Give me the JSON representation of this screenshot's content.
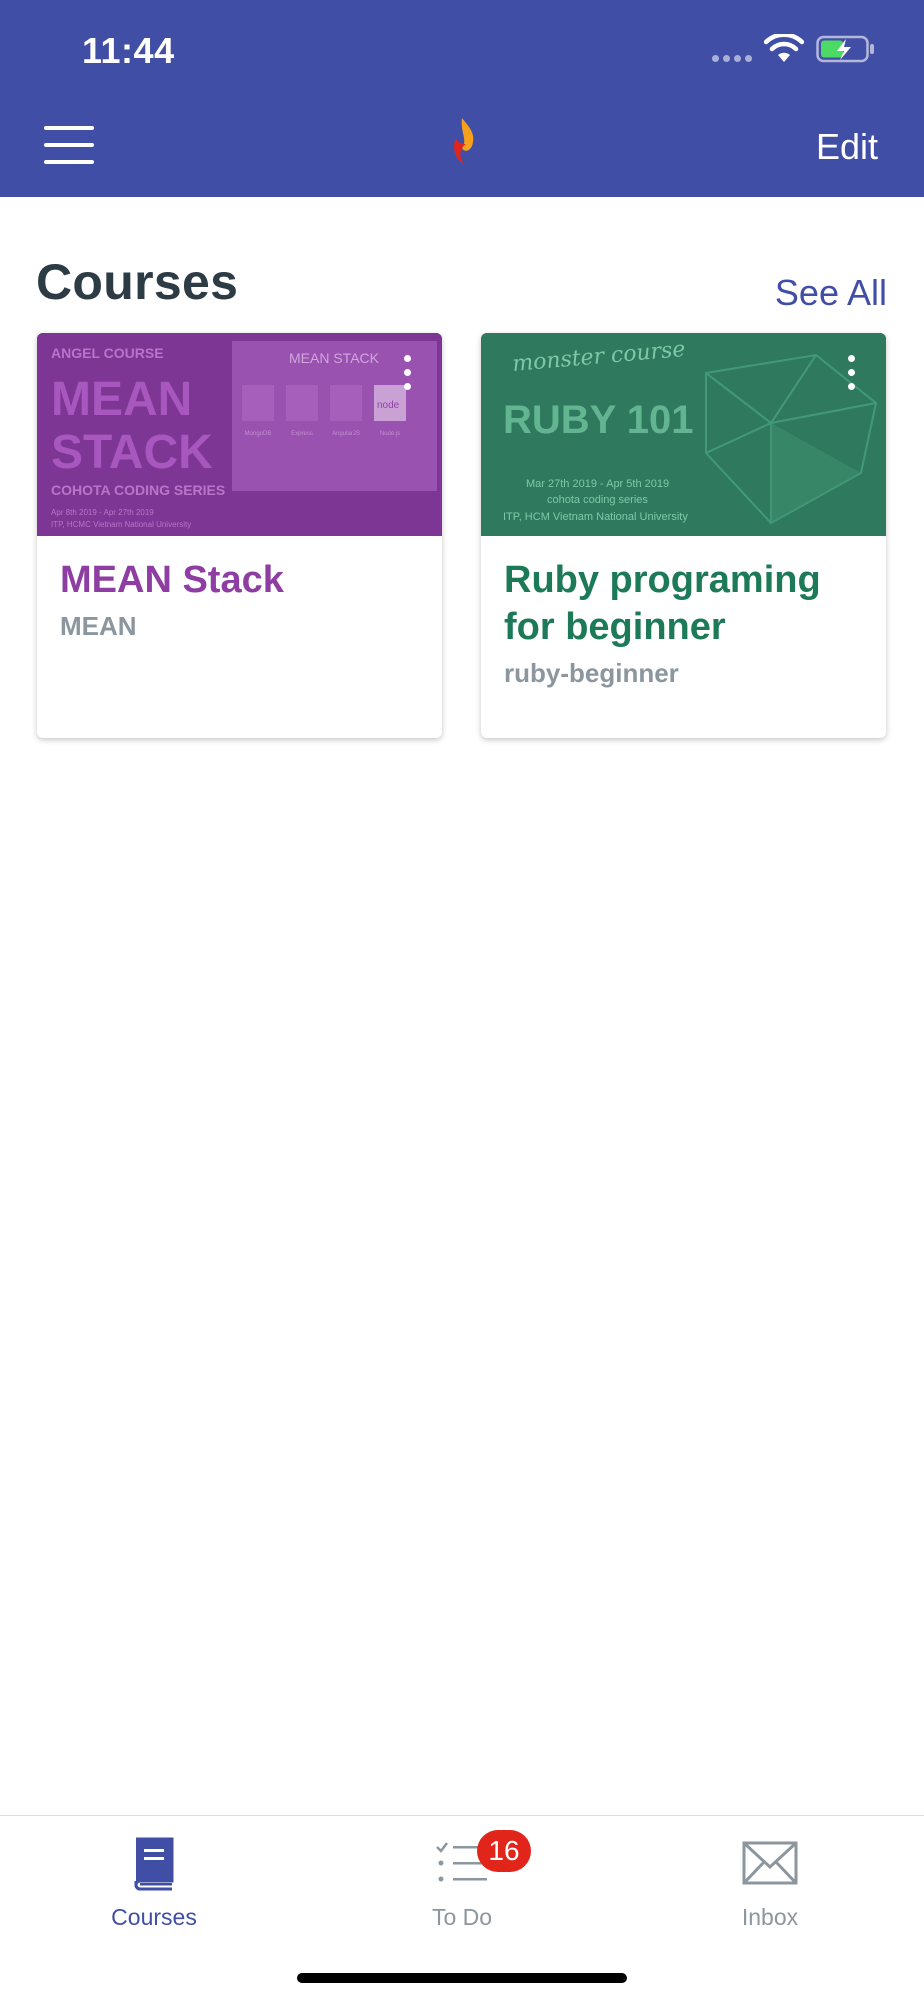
{
  "status_bar": {
    "time": "11:44"
  },
  "header": {
    "edit_label": "Edit"
  },
  "section": {
    "title": "Courses",
    "see_all_label": "See All"
  },
  "courses": [
    {
      "thumbnail_text": {
        "kicker": "ANGEL COURSE",
        "line1": "MEAN",
        "line2": "STACK",
        "series": "COHOTA CODING SERIES",
        "dates": "Apr 8th 2019 - Apr 27th 2019",
        "place": "ITP, HCMC Vietnam National University",
        "panel_title": "MEAN STACK",
        "panel_items": [
          "MongoDB",
          "Express",
          "AngularJS",
          "Node.js"
        ],
        "panel_badge": "node"
      },
      "name": "MEAN Stack",
      "code": "MEAN",
      "color": "#8e44a6"
    },
    {
      "thumbnail_text": {
        "kicker": "monster course",
        "line1": "RUBY 101",
        "dates": "Mar 27th 2019 - Apr 5th 2019",
        "series": "cohota coding series",
        "place": "ITP, HCM Vietnam National University"
      },
      "name": "Ruby programing for beginner",
      "code": "ruby-beginner",
      "color": "#2f7a5e"
    }
  ],
  "tabbar": {
    "items": [
      {
        "label": "Courses",
        "icon": "book-icon",
        "active": true
      },
      {
        "label": "To Do",
        "icon": "checklist-icon",
        "badge": "16"
      },
      {
        "label": "Inbox",
        "icon": "envelope-icon"
      }
    ]
  },
  "colors": {
    "brand": "#414ea5",
    "text_dark": "#2d3b45",
    "muted": "#8b969e",
    "badge": "#e1251b"
  }
}
